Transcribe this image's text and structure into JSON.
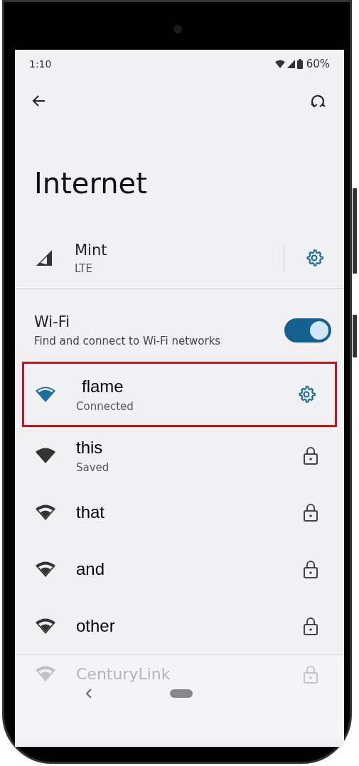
{
  "status_bar": {
    "time": "1:10",
    "battery": "60%"
  },
  "title": "Internet",
  "mobile": {
    "name": "Mint",
    "type": "LTE"
  },
  "wifi": {
    "label": "Wi-Fi",
    "description": "Find and connect to Wi-Fi networks",
    "on": true
  },
  "networks": [
    {
      "name": "flame",
      "status": "Connected",
      "connected": true,
      "highlighted": true,
      "locked": false,
      "faded": false
    },
    {
      "name": "this",
      "status": "Saved",
      "connected": false,
      "highlighted": false,
      "locked": true,
      "faded": false
    },
    {
      "name": "that",
      "connected": false,
      "highlighted": false,
      "locked": true,
      "faded": false
    },
    {
      "name": "and",
      "connected": false,
      "highlighted": false,
      "locked": true,
      "faded": false
    },
    {
      "name": "other",
      "connected": false,
      "highlighted": false,
      "locked": true,
      "faded": false
    },
    {
      "name": "CenturyLink",
      "connected": false,
      "highlighted": false,
      "locked": true,
      "faded": true
    }
  ]
}
